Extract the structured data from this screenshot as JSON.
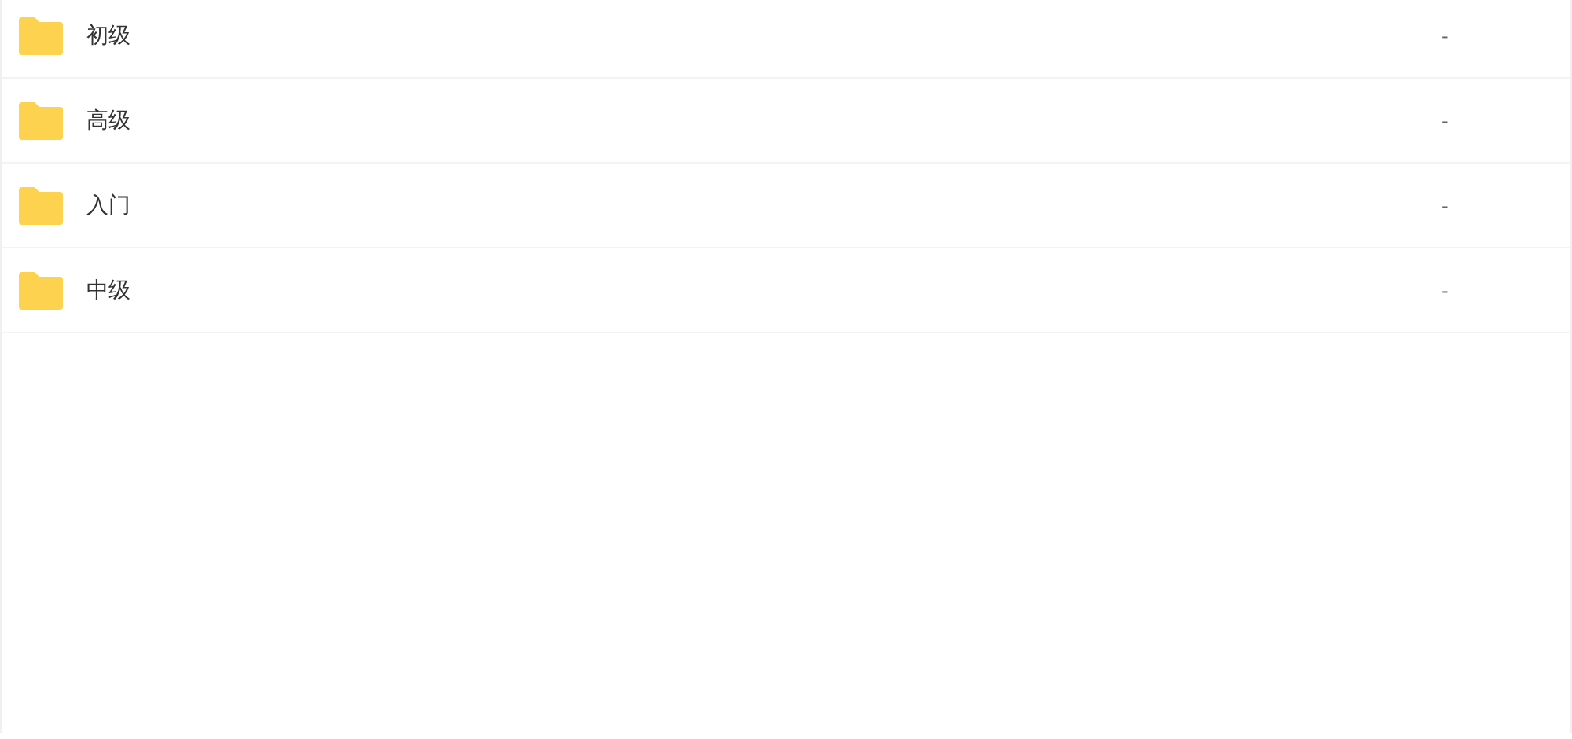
{
  "files": [
    {
      "name": "初级",
      "size": "-"
    },
    {
      "name": "高级",
      "size": "-"
    },
    {
      "name": "入门",
      "size": "-"
    },
    {
      "name": "中级",
      "size": "-"
    }
  ]
}
